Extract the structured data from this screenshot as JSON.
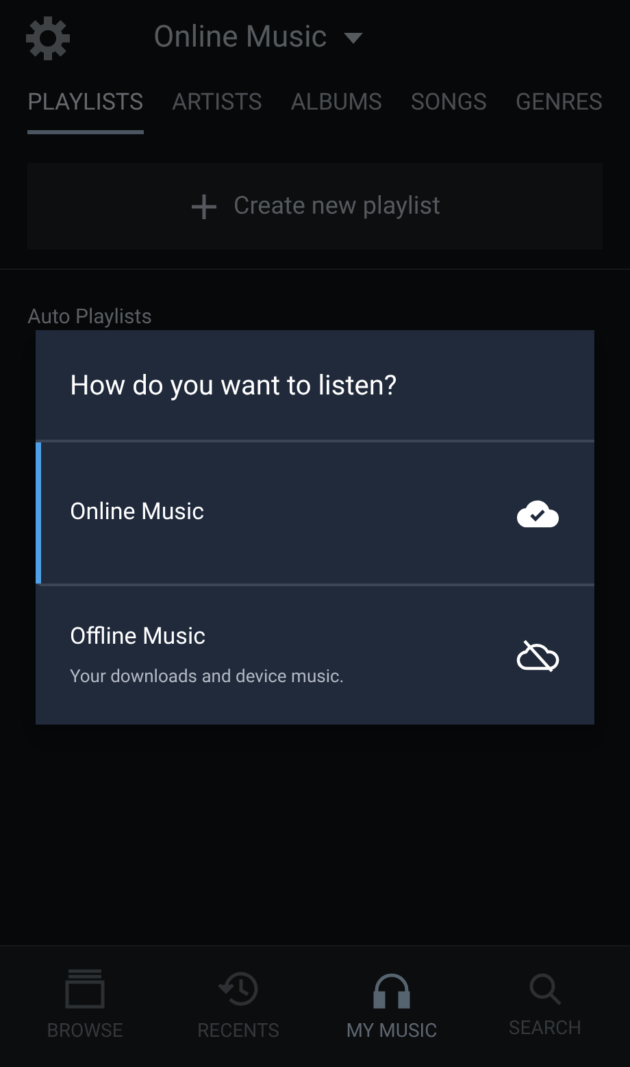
{
  "header": {
    "title": "Online Music"
  },
  "tabs": [
    {
      "label": "PLAYLISTS",
      "selected": true
    },
    {
      "label": "ARTISTS",
      "selected": false
    },
    {
      "label": "ALBUMS",
      "selected": false
    },
    {
      "label": "SONGS",
      "selected": false
    },
    {
      "label": "GENRES",
      "selected": false
    }
  ],
  "create_button": {
    "label": "Create new playlist"
  },
  "section_title": "Auto Playlists",
  "dialog": {
    "title": "How do you want to listen?",
    "options": [
      {
        "label": "Online Music",
        "kind": "online",
        "selected": true
      },
      {
        "label": "Offline Music",
        "subtitle": "Your downloads and device music.",
        "kind": "offline",
        "selected": false
      }
    ]
  },
  "bottom_nav": [
    {
      "label": "BROWSE",
      "kind": "browse",
      "selected": false
    },
    {
      "label": "RECENTS",
      "kind": "recents",
      "selected": false
    },
    {
      "label": "MY MUSIC",
      "kind": "music",
      "selected": true
    },
    {
      "label": "SEARCH",
      "kind": "search",
      "selected": false
    }
  ]
}
